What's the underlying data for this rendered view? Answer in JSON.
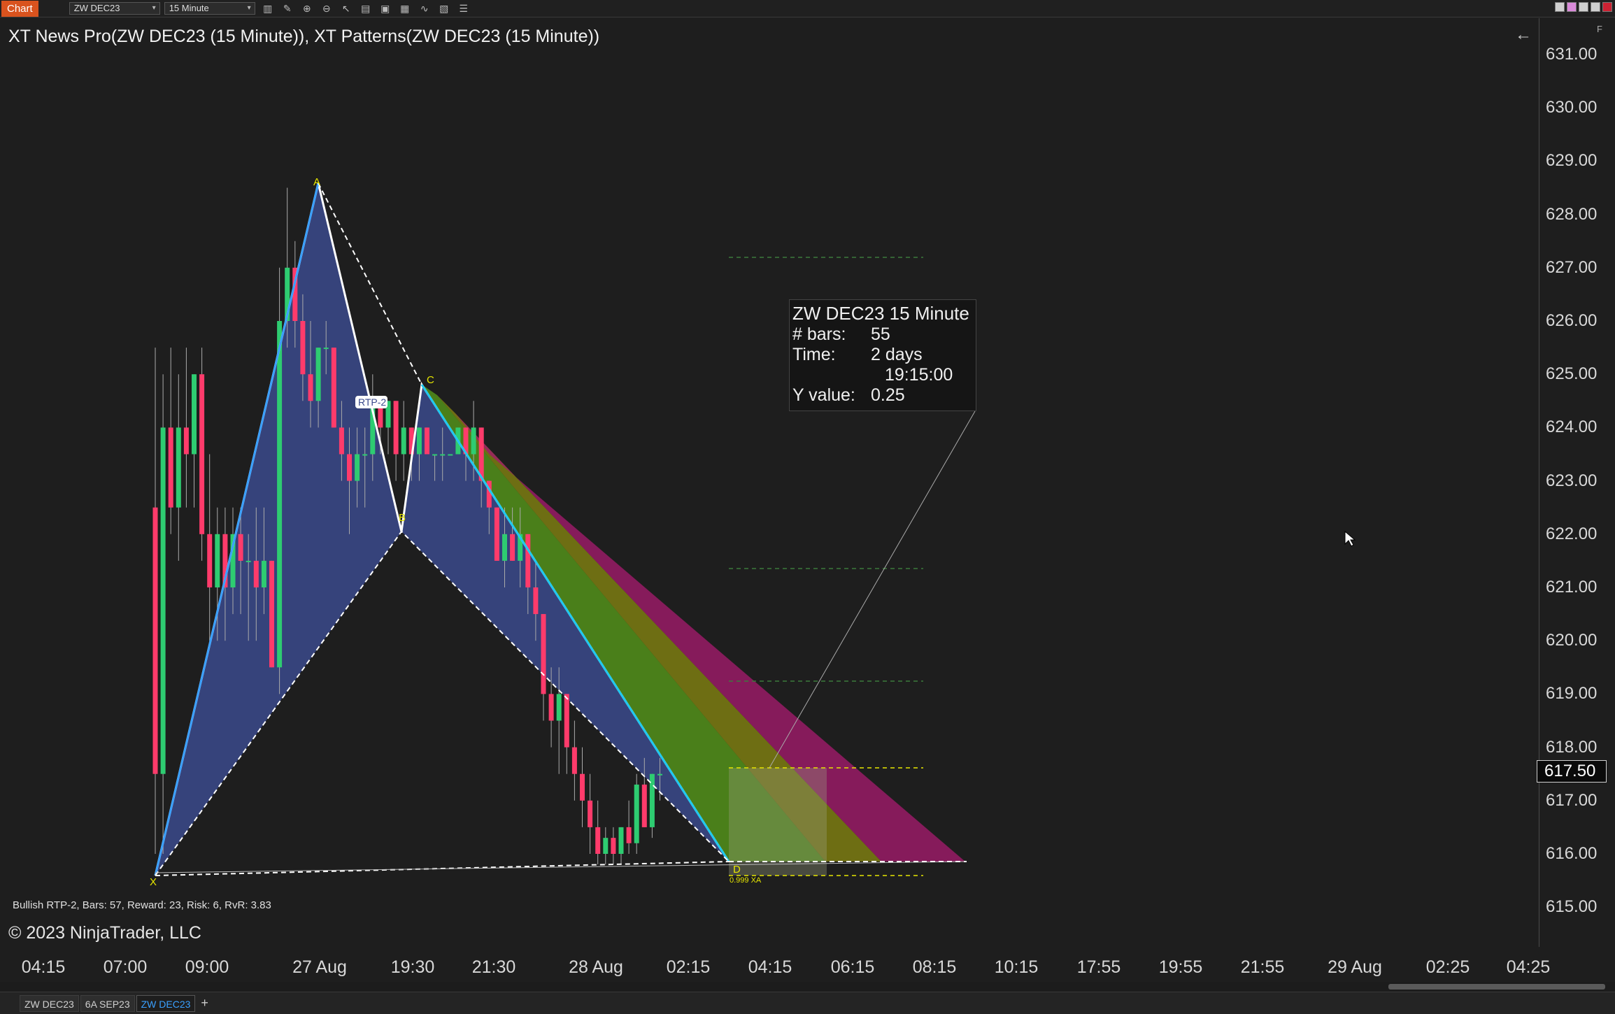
{
  "toolbar": {
    "chart_tab": "Chart",
    "instrument": "ZW DEC23",
    "timeframe": "15 Minute"
  },
  "chart": {
    "indicator_title": "XT News Pro(ZW DEC23 (15 Minute)), XT Patterns(ZW DEC23 (15 Minute))",
    "copyright": "© 2023 NinjaTrader, LLC",
    "pattern_info": "Bullish RTP-2, Bars: 57, Reward: 23, Risk: 6, RvR: 3.83",
    "pattern_label": "RTP-2",
    "current_price": "617.50",
    "points": [
      "X",
      "A",
      "B",
      "C",
      "D"
    ],
    "fib_level": "0.999 XA",
    "colors": {
      "bull": "#2ecc71",
      "bear": "#ff3b6b",
      "accent": "#d9531e",
      "pattern_fill": "#3b4a8c"
    }
  },
  "price_axis": [
    "631.00",
    "630.00",
    "629.00",
    "628.00",
    "627.00",
    "626.00",
    "625.00",
    "624.00",
    "623.00",
    "622.00",
    "621.00",
    "620.00",
    "619.00",
    "618.00",
    "617.00",
    "616.00",
    "615.00"
  ],
  "time_axis": [
    "04:15",
    "07:00",
    "09:00",
    "27 Aug",
    "19:30",
    "21:30",
    "28 Aug",
    "02:15",
    "04:15",
    "06:15",
    "08:15",
    "10:15",
    "17:55",
    "19:55",
    "21:55",
    "29 Aug",
    "02:25",
    "04:25"
  ],
  "tooltip": {
    "title": "ZW DEC23 15 Minute",
    "bars_label": "# bars:",
    "bars_value": "55",
    "time_label": "Time:",
    "time_value": "2 days",
    "time_value2": "19:15:00",
    "y_label": "Y value:",
    "y_value": "0.25"
  },
  "tabs": [
    "ZW DEC23",
    "6A SEP23",
    "ZW DEC23"
  ],
  "chart_data": {
    "type": "candlestick",
    "ylim": [
      614.5,
      631.5
    ],
    "candles": [
      {
        "o": 622.5,
        "h": 625.5,
        "l": 616.0,
        "c": 617.5
      },
      {
        "o": 617.5,
        "h": 625.0,
        "l": 616.0,
        "c": 624.0
      },
      {
        "o": 624.0,
        "h": 625.5,
        "l": 622.0,
        "c": 622.5
      },
      {
        "o": 622.5,
        "h": 625.0,
        "l": 621.5,
        "c": 624.0
      },
      {
        "o": 624.0,
        "h": 625.5,
        "l": 622.5,
        "c": 623.5
      },
      {
        "o": 623.5,
        "h": 625.0,
        "l": 622.5,
        "c": 625.0
      },
      {
        "o": 625.0,
        "h": 625.5,
        "l": 621.5,
        "c": 622.0
      },
      {
        "o": 622.0,
        "h": 623.5,
        "l": 620.0,
        "c": 621.0
      },
      {
        "o": 621.0,
        "h": 622.5,
        "l": 620.0,
        "c": 622.0
      },
      {
        "o": 622.0,
        "h": 622.5,
        "l": 620.0,
        "c": 621.0
      },
      {
        "o": 621.0,
        "h": 622.5,
        "l": 620.5,
        "c": 622.0
      },
      {
        "o": 622.0,
        "h": 622.5,
        "l": 620.5,
        "c": 621.5
      },
      {
        "o": 621.5,
        "h": 622.0,
        "l": 620.0,
        "c": 621.5
      },
      {
        "o": 621.5,
        "h": 622.5,
        "l": 620.0,
        "c": 621.0
      },
      {
        "o": 621.0,
        "h": 622.5,
        "l": 620.5,
        "c": 621.5
      },
      {
        "o": 621.5,
        "h": 621.5,
        "l": 619.5,
        "c": 619.5
      },
      {
        "o": 619.5,
        "h": 627.0,
        "l": 619.0,
        "c": 626.0
      },
      {
        "o": 626.0,
        "h": 628.5,
        "l": 625.5,
        "c": 627.0
      },
      {
        "o": 627.0,
        "h": 627.5,
        "l": 625.5,
        "c": 626.0
      },
      {
        "o": 626.0,
        "h": 626.5,
        "l": 624.5,
        "c": 625.0
      },
      {
        "o": 625.0,
        "h": 626.0,
        "l": 624.0,
        "c": 624.5
      },
      {
        "o": 624.5,
        "h": 625.5,
        "l": 624.0,
        "c": 625.5
      },
      {
        "o": 625.5,
        "h": 626.0,
        "l": 625.0,
        "c": 625.5
      },
      {
        "o": 625.5,
        "h": 625.5,
        "l": 624.0,
        "c": 624.0
      },
      {
        "o": 624.0,
        "h": 624.5,
        "l": 623.0,
        "c": 623.5
      },
      {
        "o": 623.5,
        "h": 624.0,
        "l": 622.0,
        "c": 623.0
      },
      {
        "o": 623.0,
        "h": 624.0,
        "l": 622.5,
        "c": 623.5
      },
      {
        "o": 623.5,
        "h": 624.0,
        "l": 622.5,
        "c": 623.5
      },
      {
        "o": 623.5,
        "h": 625.0,
        "l": 623.0,
        "c": 624.5
      },
      {
        "o": 624.5,
        "h": 624.5,
        "l": 623.5,
        "c": 624.0
      },
      {
        "o": 624.0,
        "h": 624.5,
        "l": 623.5,
        "c": 624.5
      },
      {
        "o": 624.5,
        "h": 624.5,
        "l": 623.0,
        "c": 623.5
      },
      {
        "o": 623.5,
        "h": 624.5,
        "l": 623.0,
        "c": 624.0
      },
      {
        "o": 624.0,
        "h": 624.0,
        "l": 623.0,
        "c": 623.5
      },
      {
        "o": 623.5,
        "h": 624.0,
        "l": 623.0,
        "c": 624.0
      },
      {
        "o": 624.0,
        "h": 624.0,
        "l": 623.5,
        "c": 623.5
      },
      {
        "o": 623.5,
        "h": 623.5,
        "l": 623.0,
        "c": 623.5
      },
      {
        "o": 623.5,
        "h": 624.0,
        "l": 623.0,
        "c": 623.5
      },
      {
        "o": 623.5,
        "h": 623.5,
        "l": 623.5,
        "c": 623.5
      },
      {
        "o": 623.5,
        "h": 624.0,
        "l": 623.5,
        "c": 624.0
      },
      {
        "o": 624.0,
        "h": 624.0,
        "l": 623.0,
        "c": 623.5
      },
      {
        "o": 623.5,
        "h": 624.5,
        "l": 623.0,
        "c": 624.0
      },
      {
        "o": 624.0,
        "h": 624.0,
        "l": 622.5,
        "c": 623.0
      },
      {
        "o": 623.0,
        "h": 623.0,
        "l": 622.0,
        "c": 622.5
      },
      {
        "o": 622.5,
        "h": 622.5,
        "l": 621.5,
        "c": 621.5
      },
      {
        "o": 621.5,
        "h": 622.5,
        "l": 621.0,
        "c": 622.0
      },
      {
        "o": 622.0,
        "h": 622.5,
        "l": 621.5,
        "c": 621.5
      },
      {
        "o": 621.5,
        "h": 622.5,
        "l": 621.0,
        "c": 622.0
      },
      {
        "o": 622.0,
        "h": 622.0,
        "l": 620.5,
        "c": 621.0
      },
      {
        "o": 621.0,
        "h": 621.5,
        "l": 620.0,
        "c": 620.5
      },
      {
        "o": 620.5,
        "h": 620.5,
        "l": 618.5,
        "c": 619.0
      },
      {
        "o": 619.0,
        "h": 619.5,
        "l": 618.0,
        "c": 618.5
      },
      {
        "o": 618.5,
        "h": 619.5,
        "l": 617.5,
        "c": 619.0
      },
      {
        "o": 619.0,
        "h": 619.0,
        "l": 617.5,
        "c": 618.0
      },
      {
        "o": 618.0,
        "h": 618.5,
        "l": 617.0,
        "c": 617.5
      },
      {
        "o": 617.5,
        "h": 618.0,
        "l": 616.5,
        "c": 617.0
      },
      {
        "o": 617.0,
        "h": 617.5,
        "l": 616.0,
        "c": 616.5
      },
      {
        "o": 616.5,
        "h": 617.0,
        "l": 615.8,
        "c": 616.0
      },
      {
        "o": 616.0,
        "h": 616.5,
        "l": 615.8,
        "c": 616.3
      },
      {
        "o": 616.3,
        "h": 616.5,
        "l": 615.8,
        "c": 616.0
      },
      {
        "o": 616.0,
        "h": 616.5,
        "l": 615.8,
        "c": 616.5
      },
      {
        "o": 616.5,
        "h": 617.0,
        "l": 616.0,
        "c": 616.2
      },
      {
        "o": 616.2,
        "h": 617.5,
        "l": 616.0,
        "c": 617.3
      },
      {
        "o": 617.3,
        "h": 617.8,
        "l": 616.5,
        "c": 616.5
      },
      {
        "o": 616.5,
        "h": 617.5,
        "l": 616.3,
        "c": 617.5
      },
      {
        "o": 617.5,
        "h": 617.8,
        "l": 617.0,
        "c": 617.5
      }
    ]
  }
}
